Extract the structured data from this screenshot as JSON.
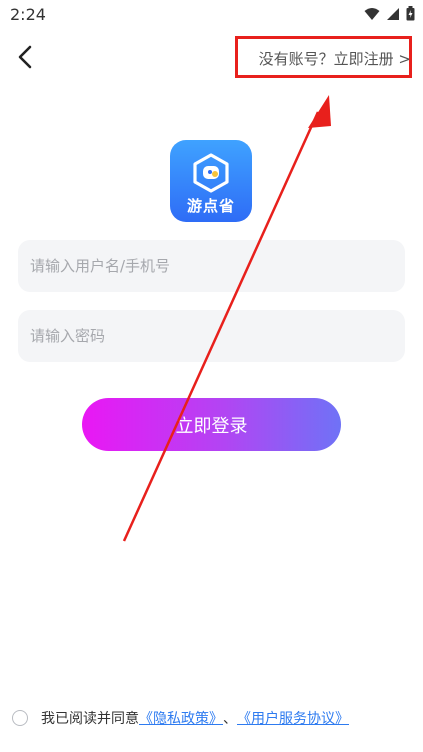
{
  "status_bar": {
    "time": "2:24",
    "icons": [
      "wifi-icon",
      "signal-icon",
      "battery-charging-icon"
    ]
  },
  "nav": {
    "back_icon": "chevron-left-icon",
    "register_text": "没有账号？立即注册 >"
  },
  "logo": {
    "text": "游点省",
    "colors": {
      "top": "#3fa2ff",
      "bottom": "#2e6cf6"
    }
  },
  "form": {
    "username_placeholder": "请输入用户名/手机号",
    "password_placeholder": "请输入密码",
    "login_button": "立即登录"
  },
  "agreement": {
    "prefix": "我已阅读并同意",
    "privacy_link": "《隐私政策》",
    "separator": "、",
    "service_link": "《用户服务协议》",
    "checked": false
  },
  "annotation": {
    "color": "#e8201c"
  },
  "colors": {
    "button_gradient_start": "#ea17f4",
    "button_gradient_end": "#6f72f6",
    "link": "#2e7bf0",
    "input_bg": "#f4f5f7"
  }
}
